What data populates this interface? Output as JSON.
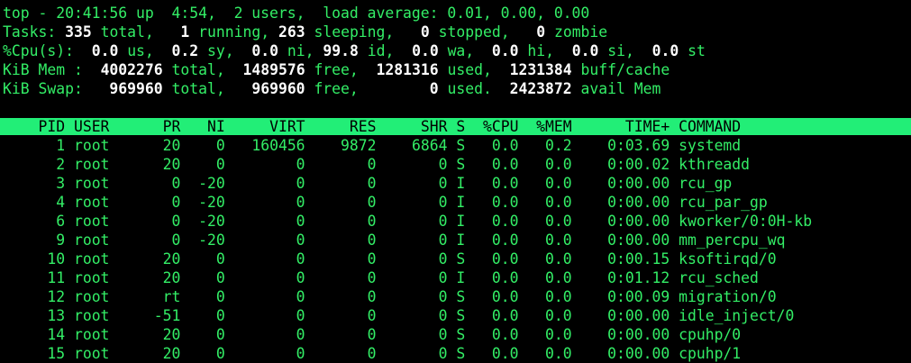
{
  "summary": {
    "line1": "top - 20:41:56 up  4:54,  2 users,  load average: 0.01, 0.00, 0.00",
    "tasks": {
      "label": "Tasks:",
      "total": "335",
      "total_label": "total,",
      "running": "1",
      "running_label": "running,",
      "sleeping": "263",
      "sleeping_label": "sleeping,",
      "stopped": "0",
      "stopped_label": "stopped,",
      "zombie": "0",
      "zombie_label": "zombie"
    },
    "cpu": {
      "label": "%Cpu(s):",
      "us": "0.0",
      "us_label": "us,",
      "sy": "0.2",
      "sy_label": "sy,",
      "ni": "0.0",
      "ni_label": "ni,",
      "id": "99.8",
      "id_label": "id,",
      "wa": "0.0",
      "wa_label": "wa,",
      "hi": "0.0",
      "hi_label": "hi,",
      "si": "0.0",
      "si_label": "si,",
      "st": "0.0",
      "st_label": "st"
    },
    "mem": {
      "label": "KiB Mem :",
      "total": "4002276",
      "total_label": "total,",
      "free": "1489576",
      "free_label": "free,",
      "used": "1281316",
      "used_label": "used,",
      "buff": "1231384",
      "buff_label": "buff/cache"
    },
    "swap": {
      "label": "KiB Swap:",
      "total": "969960",
      "total_label": "total,",
      "free": "969960",
      "free_label": "free,",
      "used": "0",
      "used_label": "used.",
      "avail": "2423872",
      "avail_label": "avail Mem"
    }
  },
  "columns": [
    "PID",
    "USER",
    "PR",
    "NI",
    "VIRT",
    "RES",
    "SHR",
    "S",
    "%CPU",
    "%MEM",
    "TIME+",
    "COMMAND"
  ],
  "processes": [
    {
      "pid": "1",
      "user": "root",
      "pr": "20",
      "ni": "0",
      "virt": "160456",
      "res": "9872",
      "shr": "6864",
      "s": "S",
      "cpu": "0.0",
      "mem": "0.2",
      "time": "0:03.69",
      "command": "systemd"
    },
    {
      "pid": "2",
      "user": "root",
      "pr": "20",
      "ni": "0",
      "virt": "0",
      "res": "0",
      "shr": "0",
      "s": "S",
      "cpu": "0.0",
      "mem": "0.0",
      "time": "0:00.02",
      "command": "kthreadd"
    },
    {
      "pid": "3",
      "user": "root",
      "pr": "0",
      "ni": "-20",
      "virt": "0",
      "res": "0",
      "shr": "0",
      "s": "I",
      "cpu": "0.0",
      "mem": "0.0",
      "time": "0:00.00",
      "command": "rcu_gp"
    },
    {
      "pid": "4",
      "user": "root",
      "pr": "0",
      "ni": "-20",
      "virt": "0",
      "res": "0",
      "shr": "0",
      "s": "I",
      "cpu": "0.0",
      "mem": "0.0",
      "time": "0:00.00",
      "command": "rcu_par_gp"
    },
    {
      "pid": "6",
      "user": "root",
      "pr": "0",
      "ni": "-20",
      "virt": "0",
      "res": "0",
      "shr": "0",
      "s": "I",
      "cpu": "0.0",
      "mem": "0.0",
      "time": "0:00.00",
      "command": "kworker/0:0H-kb"
    },
    {
      "pid": "9",
      "user": "root",
      "pr": "0",
      "ni": "-20",
      "virt": "0",
      "res": "0",
      "shr": "0",
      "s": "I",
      "cpu": "0.0",
      "mem": "0.0",
      "time": "0:00.00",
      "command": "mm_percpu_wq"
    },
    {
      "pid": "10",
      "user": "root",
      "pr": "20",
      "ni": "0",
      "virt": "0",
      "res": "0",
      "shr": "0",
      "s": "S",
      "cpu": "0.0",
      "mem": "0.0",
      "time": "0:00.15",
      "command": "ksoftirqd/0"
    },
    {
      "pid": "11",
      "user": "root",
      "pr": "20",
      "ni": "0",
      "virt": "0",
      "res": "0",
      "shr": "0",
      "s": "I",
      "cpu": "0.0",
      "mem": "0.0",
      "time": "0:01.12",
      "command": "rcu_sched"
    },
    {
      "pid": "12",
      "user": "root",
      "pr": "rt",
      "ni": "0",
      "virt": "0",
      "res": "0",
      "shr": "0",
      "s": "S",
      "cpu": "0.0",
      "mem": "0.0",
      "time": "0:00.09",
      "command": "migration/0"
    },
    {
      "pid": "13",
      "user": "root",
      "pr": "-51",
      "ni": "0",
      "virt": "0",
      "res": "0",
      "shr": "0",
      "s": "S",
      "cpu": "0.0",
      "mem": "0.0",
      "time": "0:00.00",
      "command": "idle_inject/0"
    },
    {
      "pid": "14",
      "user": "root",
      "pr": "20",
      "ni": "0",
      "virt": "0",
      "res": "0",
      "shr": "0",
      "s": "S",
      "cpu": "0.0",
      "mem": "0.0",
      "time": "0:00.00",
      "command": "cpuhp/0"
    },
    {
      "pid": "15",
      "user": "root",
      "pr": "20",
      "ni": "0",
      "virt": "0",
      "res": "0",
      "shr": "0",
      "s": "S",
      "cpu": "0.0",
      "mem": "0.0",
      "time": "0:00.00",
      "command": "cpuhp/1"
    }
  ],
  "colors": {
    "background": "#000000",
    "text": "#33ee66",
    "highlight": "#ffffff",
    "header_bar": "#22ee77"
  }
}
